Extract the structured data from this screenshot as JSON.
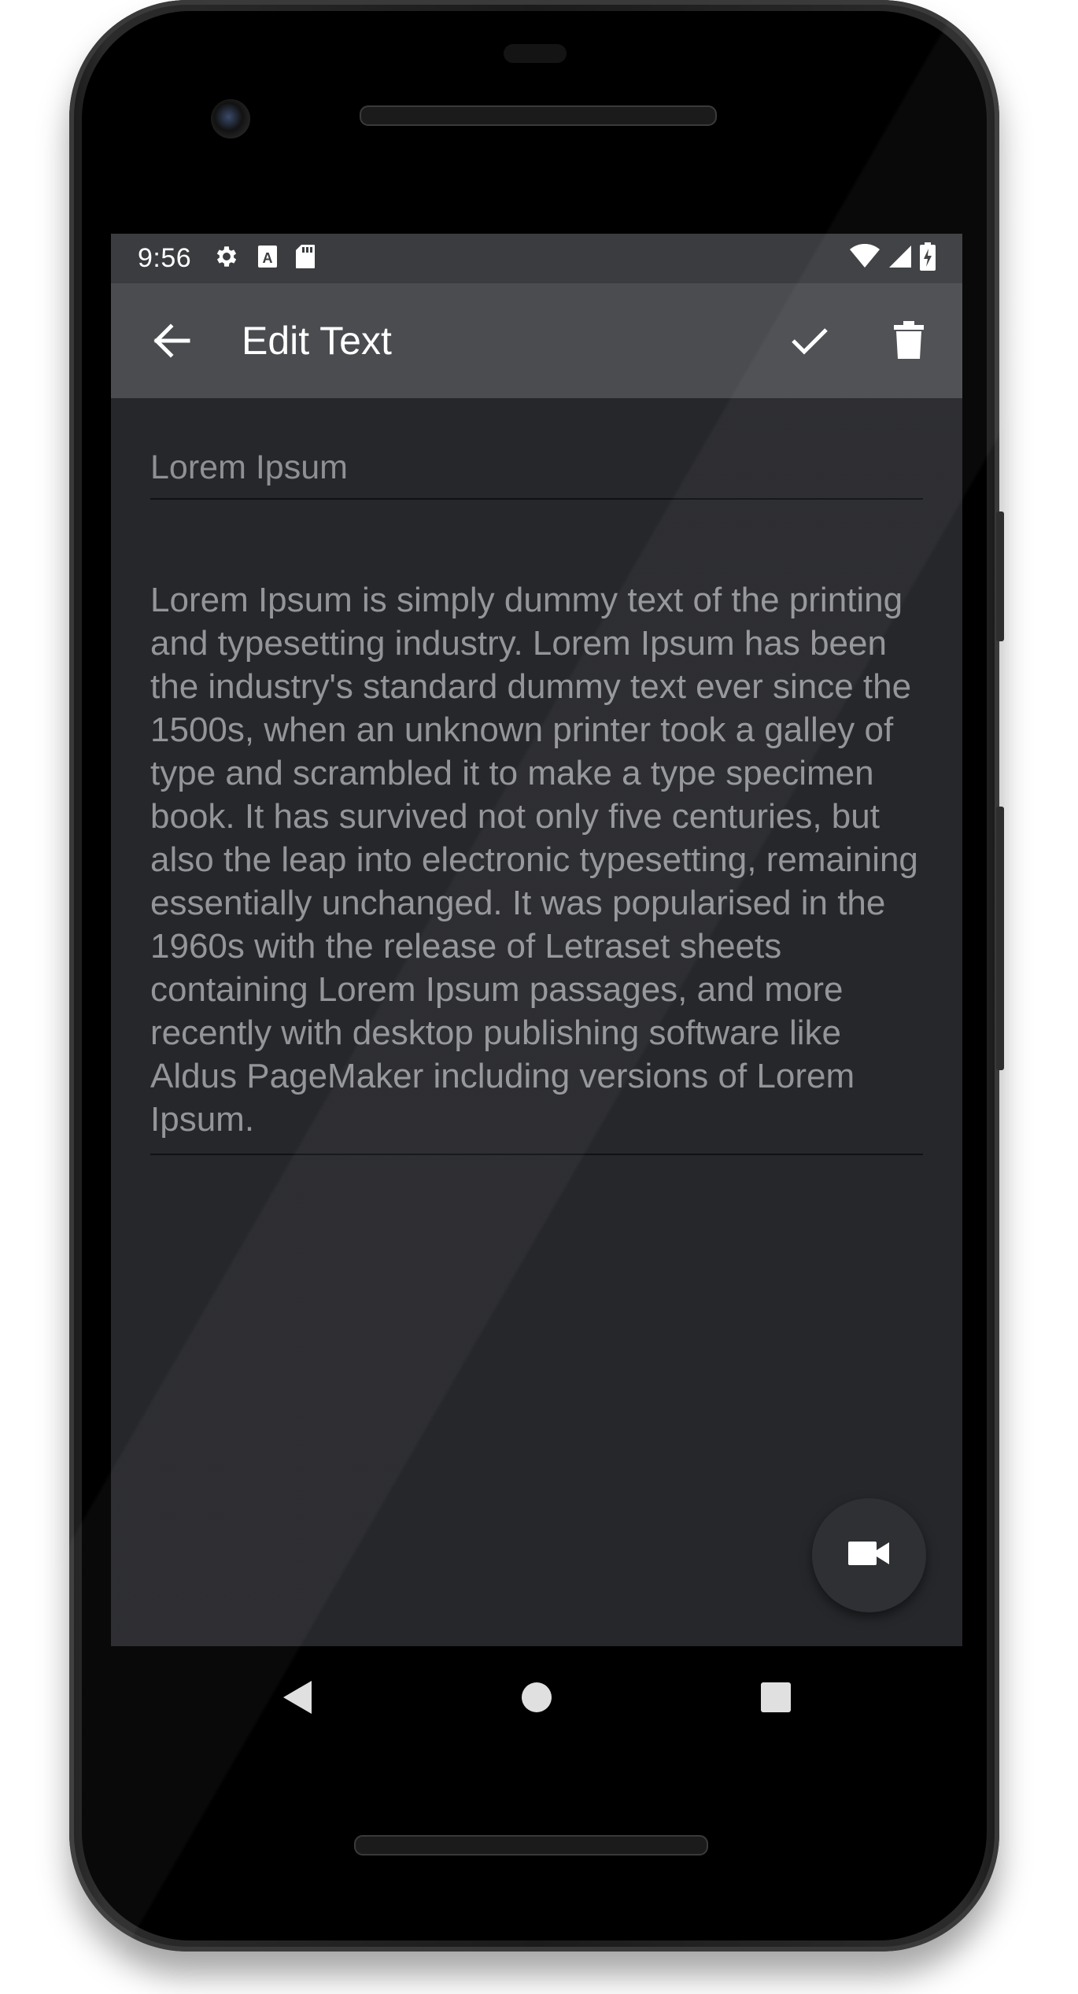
{
  "status_bar": {
    "time": "9:56",
    "left_icons": [
      "gear-icon",
      "font-a-icon",
      "sd-card-icon"
    ],
    "right_icons": [
      "wifi-icon",
      "signal-icon",
      "battery-charging-icon"
    ]
  },
  "app_bar": {
    "title": "Edit Text",
    "back_icon": "arrow-back-icon",
    "actions": [
      "check-icon",
      "delete-icon"
    ]
  },
  "editor": {
    "title_value": "Lorem Ipsum",
    "body_value": "Lorem Ipsum is simply dummy text of the printing and typesetting industry. Lorem Ipsum has been the industry's standard dummy text ever since the 1500s, when an unknown printer took a galley of type and scrambled it to make a type specimen book. It has survived not only five centuries, but also the leap into electronic typesetting, remaining essentially unchanged. It was popularised in the 1960s with the release of Letraset sheets containing Lorem Ipsum passages, and more recently with desktop publishing software like Aldus PageMaker including versions of Lorem Ipsum."
  },
  "fab": {
    "icon": "videocam-icon"
  },
  "nav_bar": {
    "icons": [
      "nav-back-icon",
      "nav-home-icon",
      "nav-recents-icon"
    ]
  },
  "colors": {
    "background": "#26272b",
    "status_bar": "#3a3c3f",
    "app_bar": "#4a4c50",
    "text_muted": "#939599"
  }
}
